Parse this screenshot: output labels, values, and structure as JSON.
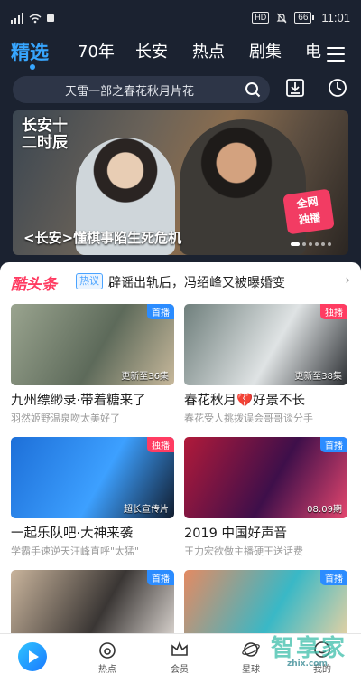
{
  "status_bar": {
    "time": "11:01",
    "battery": "66",
    "hd_label": "HD"
  },
  "tabs": [
    {
      "label": "精选",
      "active": true
    },
    {
      "label": "70年"
    },
    {
      "label": "长安"
    },
    {
      "label": "热点"
    },
    {
      "label": "剧集"
    },
    {
      "label": "电"
    }
  ],
  "search": {
    "text": "天雷一部之春花秋月片花"
  },
  "banner": {
    "logo_text": "长安十二时辰",
    "caption": "<长安>懂棋事陷生死危机",
    "badge": "全网\n独播",
    "page_count": 6,
    "active_page": 0
  },
  "headline": {
    "logo": "酷头条",
    "tag": "热议",
    "text": "辟谣出轨后，冯绍峰又被曝婚变",
    "arrow": "›"
  },
  "cards": [
    {
      "badge": "首播",
      "badge_color": "#2b8cff",
      "overlay": "更新至36集",
      "title": "九州缥缈录·带着糖来了",
      "subtitle": "羽然姬野温泉吻太美好了",
      "colors": [
        "#9aa48f",
        "#5d6a5a",
        "#c7b89b"
      ]
    },
    {
      "badge": "独播",
      "badge_color": "#ff3c62",
      "overlay": "更新至38集",
      "title": "春花秋月💔好景不长",
      "subtitle": "春花受人挑拨误会哥哥谈分手",
      "colors": [
        "#6f7f7c",
        "#dfe3e4",
        "#2c2f33"
      ]
    },
    {
      "badge": "独播",
      "badge_color": "#ff3c62",
      "overlay": "超长宣传片",
      "title": "一起乐队吧·大神来袭",
      "subtitle": "学霸手速逆天汪峰直呼\"太猛\"",
      "colors": [
        "#1d6fd8",
        "#3da0ff",
        "#111c2e"
      ]
    },
    {
      "badge": "首播",
      "badge_color": "#2b8cff",
      "overlay": "08:09期",
      "title": "2019 中国好声音",
      "subtitle": "王力宏欲做主播硬王送话费",
      "colors": [
        "#b11a3a",
        "#3e0f4a",
        "#e4466e"
      ]
    },
    {
      "badge": "首播",
      "badge_color": "#2b8cff",
      "overlay": "",
      "title": "",
      "subtitle": "",
      "colors": [
        "#c9b49c",
        "#3a3634",
        "#e7e1dc"
      ]
    },
    {
      "badge": "首播",
      "badge_color": "#2b8cff",
      "overlay": "",
      "title": "",
      "subtitle": "",
      "colors": [
        "#e48a62",
        "#39b8c6",
        "#f4d3a0"
      ]
    }
  ],
  "bottom_nav": [
    {
      "label": "",
      "icon": "play-icon"
    },
    {
      "label": "热点",
      "icon": "fire-icon"
    },
    {
      "label": "会员",
      "icon": "crown-icon"
    },
    {
      "label": "星球",
      "icon": "planet-icon"
    },
    {
      "label": "我的",
      "icon": "user-icon"
    }
  ],
  "watermark": {
    "text": "智享家",
    "sub": "zhix.com"
  },
  "colors": {
    "accent": "#37a6ff",
    "header_bg": "#1b2230",
    "hot_pink": "#ff3c62"
  }
}
